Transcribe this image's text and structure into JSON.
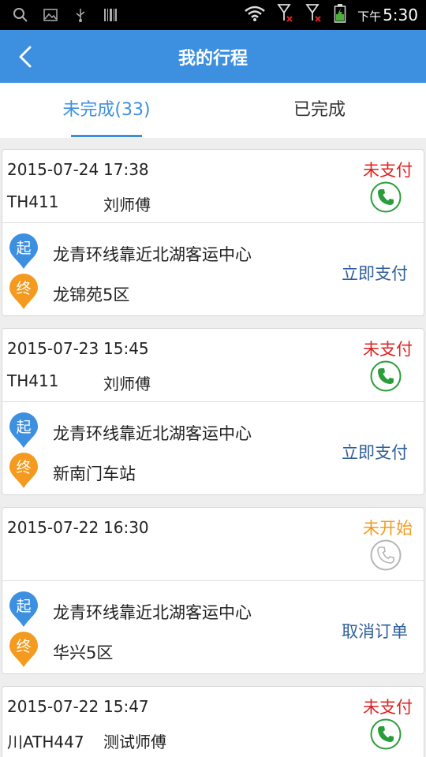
{
  "status_bar": {
    "time_prefix": "下午",
    "time": "5:30"
  },
  "header": {
    "title": "我的行程"
  },
  "tabs": [
    {
      "label": "未完成(33)"
    },
    {
      "label": "已完成"
    }
  ],
  "colors": {
    "primary": "#3d8fe0",
    "unpaid": "#e02020",
    "not_started": "#f39a1f",
    "action_link": "#2f5f9a",
    "start_pin": "#3d8fe0",
    "end_pin": "#f39a1f"
  },
  "pin_labels": {
    "start": "起",
    "end": "终"
  },
  "trips": [
    {
      "date": "2015-07-24",
      "time": "17:38",
      "plate": "TH411",
      "driver": "刘师傅",
      "status": "未支付",
      "start": "龙青环线靠近北湖客运中心",
      "end": "龙锦苑5区",
      "action": "立即支付"
    },
    {
      "date": "2015-07-23",
      "time": "15:45",
      "plate": "TH411",
      "driver": "刘师傅",
      "status": "未支付",
      "start": "龙青环线靠近北湖客运中心",
      "end": "新南门车站",
      "action": "立即支付"
    },
    {
      "date": "2015-07-22",
      "time": "16:30",
      "plate": "",
      "driver": "",
      "status": "未开始",
      "start": "龙青环线靠近北湖客运中心",
      "end": "华兴5区",
      "action": "取消订单"
    },
    {
      "date": "2015-07-22",
      "time": "15:47",
      "plate": "川ATH447",
      "driver": "测试师傅",
      "status": "未支付",
      "start": "",
      "end": "",
      "action": ""
    }
  ]
}
